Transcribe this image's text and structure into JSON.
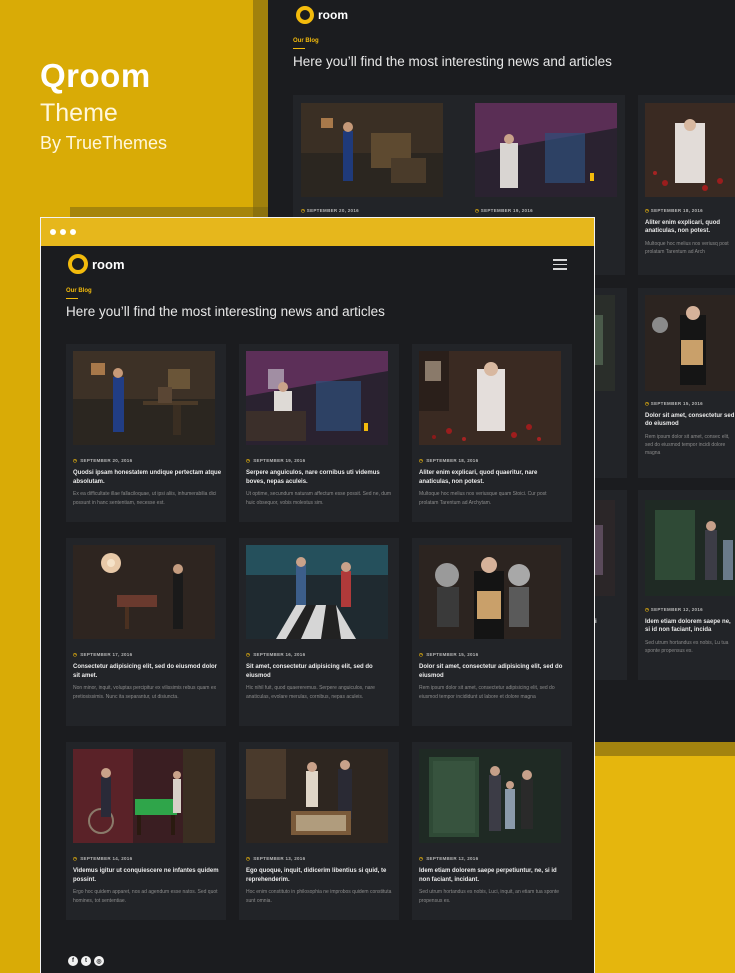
{
  "brand": {
    "title": "Qroom",
    "subtitle": "Theme",
    "by": "By TrueThemes"
  },
  "site": {
    "logo_word": "room",
    "kicker": "Our Blog",
    "heading": "Here you’ll find the most interesting news and articles",
    "menu_icon": "hamburger-menu-icon"
  },
  "colors": {
    "accent": "#f3bb0c",
    "background_gold": "#d9ab06",
    "page_dark": "#1b1c1f",
    "card_dark": "#222428"
  },
  "posts": [
    {
      "date": "SEPTEMBER 20, 2016",
      "title": "Quodsi ipsam honestatem undique pertectam atque absolutam.",
      "excerpt": "Ex ea difficultate illae fallaciloquae, ut ipsi aliis, inhumerabilia dici possunt in hanc sententiam, necesse est.",
      "scene": "blue-suit-man-at-desk"
    },
    {
      "date": "SEPTEMBER 19, 2016",
      "title": "Serpere anguiculos, nare cornibus uti videmus boves, nepas aculeis.",
      "excerpt": "Ut optime, secundum naturam affectum esse possit. Sed ne, dum huic obsequor, vobis molestus sim.",
      "scene": "bride-in-attic"
    },
    {
      "date": "SEPTEMBER 18, 2016",
      "title": "Aliter enim explicari, quod quaeritur, nare anaticulas, non potest.",
      "excerpt": "Multoque hoc melius nos veriusque quam Stoici. Cur post prolatam Tarentum ad Archytam.",
      "scene": "girl-with-rose-petals"
    },
    {
      "date": "SEPTEMBER 17, 2016",
      "title": "Consectetur adipisicing elit, sed do eiusmod dolor sit amet.",
      "excerpt": "Non minor, inquit, voluptas percipitur ex vilissimis rebus quam ex pretiosissimis. Nunc ita separantur, ut disiuncta.",
      "scene": "surgical-room"
    },
    {
      "date": "SEPTEMBER 16, 2016",
      "title": "Sit amet, consectetur adipisicing elit, sed do eiusmod",
      "excerpt": "Hic nihil fuit, quod quaereremus. Serpere anguiculos, nare anaticulas, evolare merulas, cornibus, nepas aculeis.",
      "scene": "couple-in-retro-diner"
    },
    {
      "date": "SEPTEMBER 15, 2016",
      "title": "Dolor sit amet, consectetur adipisicing elit, sed do eiusmod",
      "excerpt": "Rem ipsum dolor sit amet, consectetur adipisicing elit, sed do eiusmod tempor incididunt ut labore et dolore magna",
      "scene": "woman-with-doll"
    },
    {
      "date": "SEPTEMBER 14, 2016",
      "title": "Videmus igitur ut conquiescere ne infantes quidem possint.",
      "excerpt": "Ergo hoc quidem apparet, nos ad agendum esse natos. Sed quot homines, tot sententiae.",
      "scene": "billiard-room-bicycle"
    },
    {
      "date": "SEPTEMBER 13, 2016",
      "title": "Ego quoque, inquit, didicerim libentius si quid, te reprehenderim.",
      "excerpt": "Hoc enim constituto in philosophia ne improbos quidem constituta sunt omnia.",
      "scene": "couple-searching-clues"
    },
    {
      "date": "SEPTEMBER 12, 2016",
      "title": "Idem etiam dolorem saepe perpetiuntur, ne, si id non faciant, incidant.",
      "excerpt": "Sed utrum hortandus es nobis, Luci, inquit, an etiam tua sponte propensus es.",
      "scene": "family-in-green-room"
    }
  ],
  "social": [
    {
      "icon": "facebook-icon",
      "glyph": "f"
    },
    {
      "icon": "twitter-icon",
      "glyph": "t"
    },
    {
      "icon": "instagram-icon",
      "glyph": "◎"
    }
  ]
}
